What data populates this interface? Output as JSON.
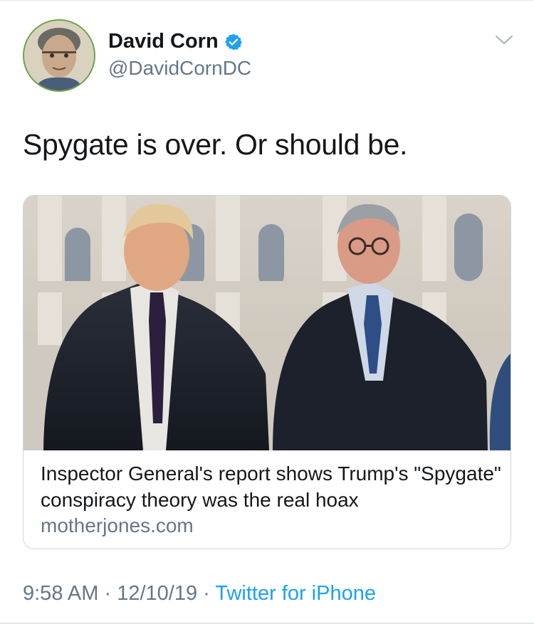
{
  "author": {
    "name": "David Corn",
    "handle": "@DavidCornDC",
    "verified": true,
    "verified_color": "#1da1f2"
  },
  "icons": {
    "menu": "chevron-down-icon",
    "verified": "verified-badge-icon"
  },
  "tweet": {
    "text": "Spygate is over. Or should be."
  },
  "card": {
    "title": "Inspector General's report shows Trump's \"Spygate\" conspiracy theory was the real hoax",
    "domain": "motherjones.com"
  },
  "meta": {
    "time": "9:58 AM",
    "sep1": " · ",
    "date": "12/10/19",
    "sep2": " · ",
    "source": "Twitter for iPhone"
  },
  "colors": {
    "link": "#1da1f2",
    "secondary_text": "#657786",
    "primary_text": "#14171a",
    "border": "#ccd6dd"
  }
}
